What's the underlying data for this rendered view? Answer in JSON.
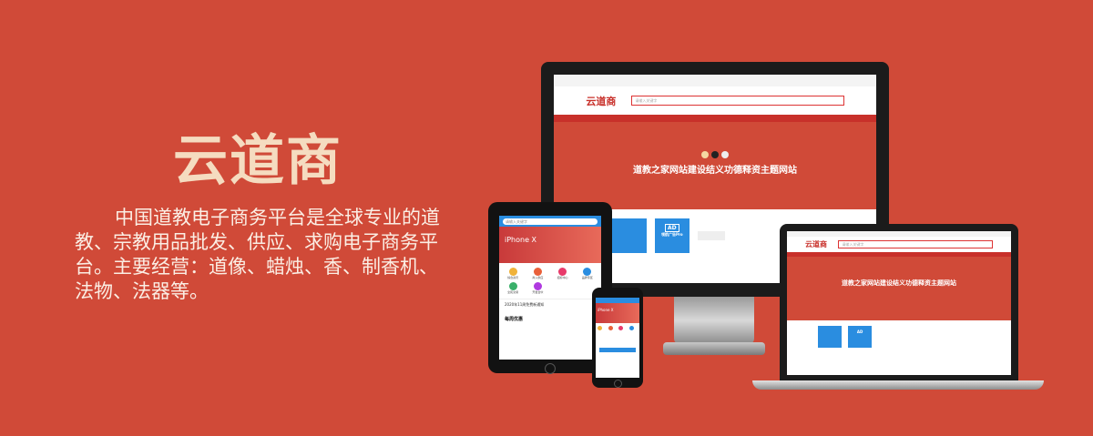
{
  "hero": {
    "brand": "云道商",
    "description": "中国道教电子商务平台是全球专业的道教、宗教用品批发、供应、求购电子商务平台。主要经营：道像、蜡烛、香、制香机、法物、法器等。"
  },
  "site": {
    "logo": "云道商",
    "search_placeholder": "请输入关键字",
    "banner_title": "道教之家网站建设结义功德释资主题网站",
    "ad_label": "AD",
    "ad_text": "领航广告Pro"
  },
  "mobile": {
    "search_placeholder": "请输入关键字",
    "promo_title": "iPhone X",
    "grid": [
      "综合资讯",
      "商入供应",
      "招标中心",
      "品牌专区",
      "全民交易",
      "开发合伙"
    ],
    "news": "2020年11周免费新通知",
    "section_title": "每周优惠"
  },
  "colors": {
    "background": "#d04a38",
    "brand_text": "#f5dcc0",
    "accent_blue": "#2a8de0"
  }
}
